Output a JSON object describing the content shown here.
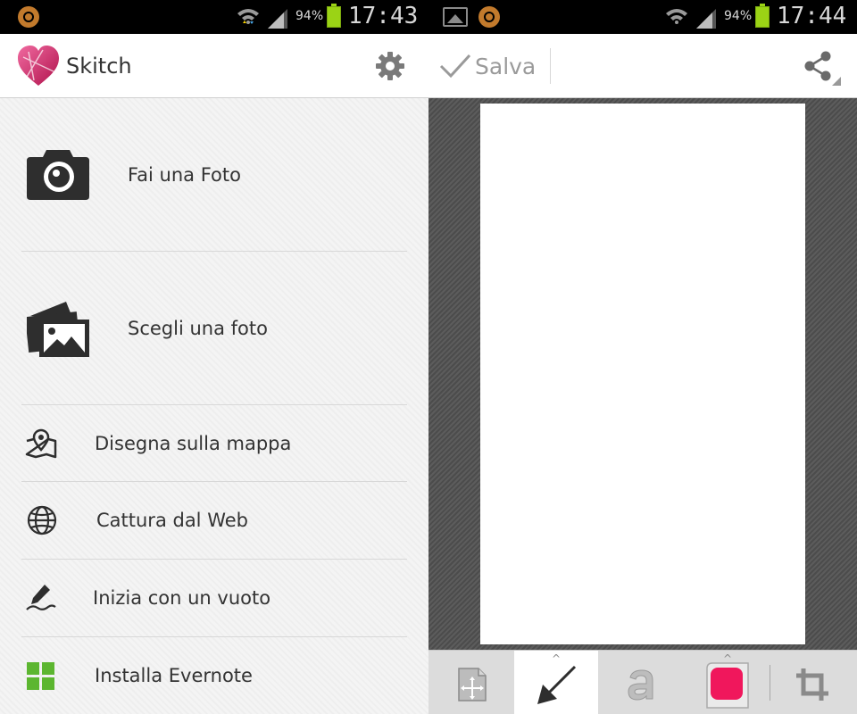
{
  "left_screen": {
    "status_bar": {
      "battery_percent": "94%",
      "time": "17:43"
    },
    "app_bar": {
      "title": "Skitch"
    },
    "menu": {
      "items": [
        {
          "label": "Fai una Foto",
          "icon": "camera-icon"
        },
        {
          "label": "Scegli una foto",
          "icon": "photo-gallery-icon"
        },
        {
          "label": "Disegna sulla mappa",
          "icon": "map-pin-icon"
        },
        {
          "label": "Cattura dal Web",
          "icon": "globe-icon"
        },
        {
          "label": "Inizia con un vuoto",
          "icon": "pen-icon"
        },
        {
          "label": "Installa Evernote",
          "icon": "grid-icon"
        }
      ]
    }
  },
  "right_screen": {
    "status_bar": {
      "battery_percent": "94%",
      "time": "17:44"
    },
    "app_bar": {
      "save_label": "Salva",
      "share_icon": "share-icon"
    },
    "toolbar": {
      "tools": [
        "move-icon",
        "arrow-tool-icon",
        "text-tool-icon",
        "color-swatch-icon",
        "crop-icon"
      ],
      "active_tool": "arrow-tool-icon",
      "color_swatch": "#f0175c"
    }
  },
  "colors": {
    "accent_pink": "#f0175c",
    "battery_green": "#9bd315",
    "evernote_green": "#5cb630"
  }
}
